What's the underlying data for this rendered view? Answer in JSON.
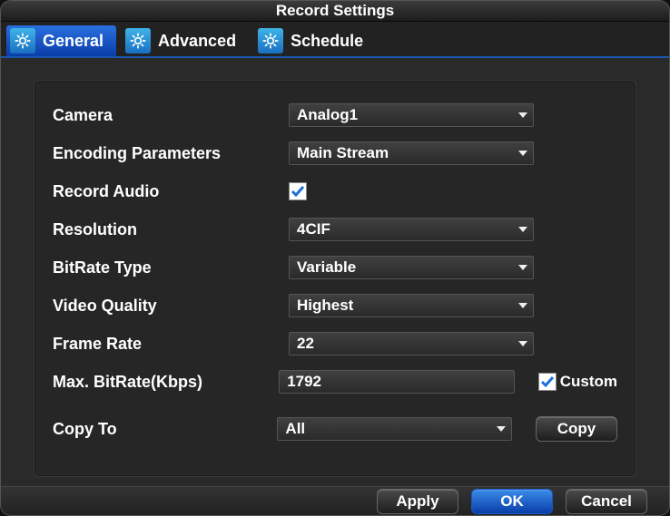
{
  "window": {
    "title": "Record Settings"
  },
  "tabs": {
    "general": "General",
    "advanced": "Advanced",
    "schedule": "Schedule"
  },
  "form": {
    "camera": {
      "label": "Camera",
      "value": "Analog1"
    },
    "encoding": {
      "label": "Encoding Parameters",
      "value": "Main Stream"
    },
    "recordAudio": {
      "label": "Record Audio",
      "checked": true
    },
    "resolution": {
      "label": "Resolution",
      "value": "4CIF"
    },
    "bitrateType": {
      "label": "BitRate Type",
      "value": "Variable"
    },
    "videoQuality": {
      "label": "Video Quality",
      "value": "Highest"
    },
    "frameRate": {
      "label": "Frame Rate",
      "value": "22"
    },
    "maxBitrate": {
      "label": "Max. BitRate(Kbps)",
      "value": "1792",
      "customLabel": "Custom",
      "customChecked": true
    },
    "copyTo": {
      "label": "Copy To",
      "value": "All",
      "button": "Copy"
    }
  },
  "footer": {
    "apply": "Apply",
    "ok": "OK",
    "cancel": "Cancel"
  }
}
